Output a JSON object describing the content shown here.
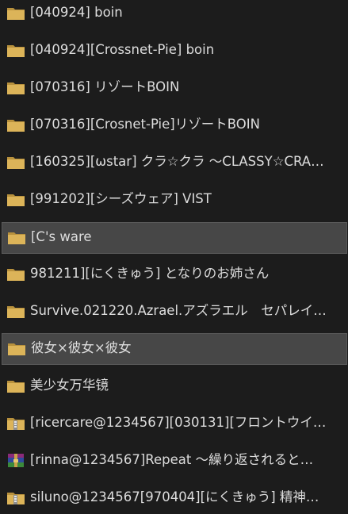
{
  "items": [
    {
      "label": "[040924] boin",
      "icon": "folder-icon",
      "selected": false
    },
    {
      "label": "[040924][Crossnet-Pie] boin",
      "icon": "folder-icon",
      "selected": false
    },
    {
      "label": "[070316] リゾートBOIN",
      "icon": "folder-icon",
      "selected": false
    },
    {
      "label": "[070316][Crosnet-Pie]リゾートBOIN",
      "icon": "folder-icon",
      "selected": false
    },
    {
      "label": "[160325][ωstar] クラ☆クラ ～CLASSY☆CRA…",
      "icon": "folder-icon",
      "selected": false
    },
    {
      "label": "[991202][シーズウェア] VIST",
      "icon": "folder-icon",
      "selected": false
    },
    {
      "label": "[C's ware",
      "icon": "folder-icon",
      "selected": true
    },
    {
      "label": "981211][にくきゅう] となりのお姉さん",
      "icon": "folder-icon",
      "selected": false
    },
    {
      "label": "Survive.021220.Azrael.アズラエル　セパレイ…",
      "icon": "folder-icon",
      "selected": false
    },
    {
      "label": "彼女×彼女×彼女",
      "icon": "folder-icon",
      "selected": true
    },
    {
      "label": "美少女万华镜",
      "icon": "folder-icon",
      "selected": false
    },
    {
      "label": "[ricercare@1234567][030131][フロントウイ…",
      "icon": "zip-folder-icon",
      "selected": false
    },
    {
      "label": "[rinna@1234567]Repeat ～繰り返されると…",
      "icon": "winrar-archive-icon",
      "selected": false
    },
    {
      "label": "siluno@1234567[970404][にくきゅう] 精神…",
      "icon": "zip-folder-icon",
      "selected": false
    }
  ],
  "colors": {
    "background": "#1c1c1c",
    "text": "#dddddd",
    "selection": "#474747",
    "folder": "#dcb459"
  }
}
